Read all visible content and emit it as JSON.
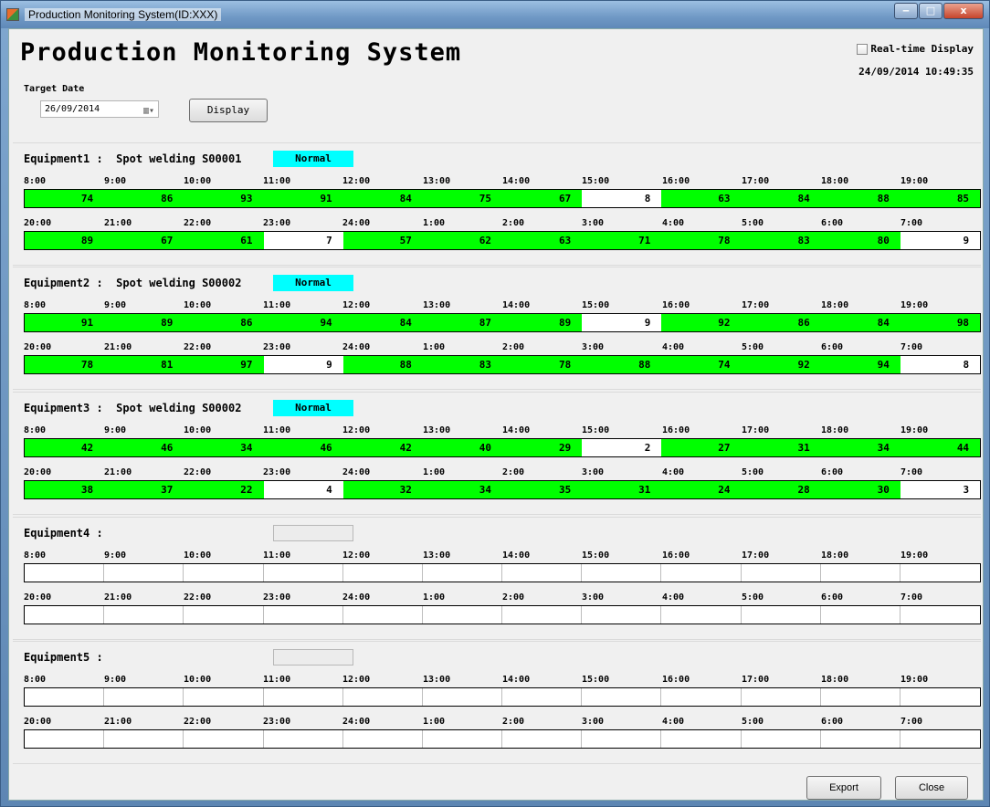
{
  "window": {
    "title": "Production Monitoring System(ID:XXX)",
    "min": "‒",
    "max": "□",
    "close": "x"
  },
  "header": {
    "app_title": "Production Monitoring System",
    "realtime_label": "Real-time Display",
    "clock": "24/09/2014 10:49:35"
  },
  "filter": {
    "target_date_label": "Target Date",
    "date_value": "26/09/2014",
    "display_button": "Display"
  },
  "hours_row1": [
    "8:00",
    "9:00",
    "10:00",
    "11:00",
    "12:00",
    "13:00",
    "14:00",
    "15:00",
    "16:00",
    "17:00",
    "18:00",
    "19:00"
  ],
  "hours_row2": [
    "20:00",
    "21:00",
    "22:00",
    "23:00",
    "24:00",
    "1:00",
    "2:00",
    "3:00",
    "4:00",
    "5:00",
    "6:00",
    "7:00"
  ],
  "equipment": [
    {
      "title": "Equipment1 :  Spot welding S00001",
      "status": "Normal",
      "row1": [
        "74",
        "86",
        "93",
        "91",
        "84",
        "75",
        "67",
        "8",
        "63",
        "84",
        "88",
        "85"
      ],
      "row2": [
        "89",
        "67",
        "61",
        "7",
        "57",
        "62",
        "63",
        "71",
        "78",
        "83",
        "80",
        "9"
      ]
    },
    {
      "title": "Equipment2 :  Spot welding S00002",
      "status": "Normal",
      "row1": [
        "91",
        "89",
        "86",
        "94",
        "84",
        "87",
        "89",
        "9",
        "92",
        "86",
        "84",
        "98"
      ],
      "row2": [
        "78",
        "81",
        "97",
        "9",
        "88",
        "83",
        "78",
        "88",
        "74",
        "92",
        "94",
        "8"
      ]
    },
    {
      "title": "Equipment3 :  Spot welding S00002",
      "status": "Normal",
      "row1": [
        "42",
        "46",
        "34",
        "46",
        "42",
        "40",
        "29",
        "2",
        "27",
        "31",
        "34",
        "44"
      ],
      "row2": [
        "38",
        "37",
        "22",
        "4",
        "32",
        "34",
        "35",
        "31",
        "24",
        "28",
        "30",
        "3"
      ]
    },
    {
      "title": "Equipment4 :",
      "status": "",
      "row1": [],
      "row2": []
    },
    {
      "title": "Equipment5 :",
      "status": "",
      "row1": [],
      "row2": []
    }
  ],
  "footer": {
    "export_button": "Export",
    "close_button": "Close"
  },
  "colors": {
    "ok": "#00ff00",
    "low": "#ffffff",
    "status_normal": "#00ffff"
  }
}
